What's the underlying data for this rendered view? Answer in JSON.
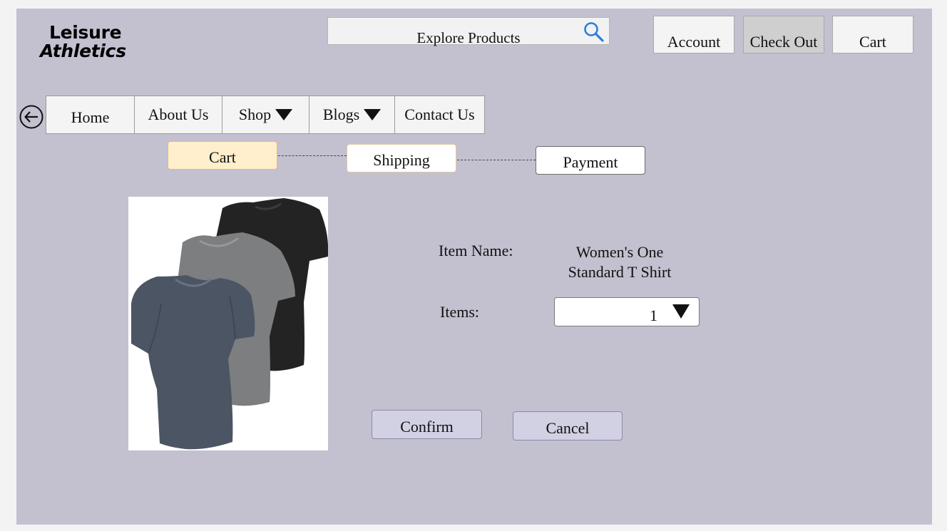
{
  "brand": {
    "line1": "Leisure",
    "line2": "Athletics"
  },
  "search": {
    "placeholder": "Explore Products",
    "icon": "search-icon"
  },
  "header_buttons": {
    "account": "Account",
    "checkout": "Check Out",
    "cart": "Cart"
  },
  "back_icon": "back-arrow-icon",
  "nav": {
    "items": [
      {
        "label": "Home"
      },
      {
        "label": "About Us"
      },
      {
        "label": "Shop",
        "dropdown": true
      },
      {
        "label": "Blogs",
        "dropdown": true
      },
      {
        "label": "Contact Us"
      }
    ]
  },
  "steps": {
    "cart": "Cart",
    "shipping": "Shipping",
    "payment": "Payment",
    "active": "Cart"
  },
  "product": {
    "item_name_label": "Item Name:",
    "item_name_line1": "Women's One",
    "item_name_line2": "Standard T Shirt",
    "items_label": "Items:",
    "quantity": "1"
  },
  "actions": {
    "confirm": "Confirm",
    "cancel": "Cancel"
  },
  "colors": {
    "canvas": "#c3c1d0",
    "active_step": "#ffefcc",
    "action_button": "#d2d0e3",
    "search_icon": "#2a7de1"
  }
}
